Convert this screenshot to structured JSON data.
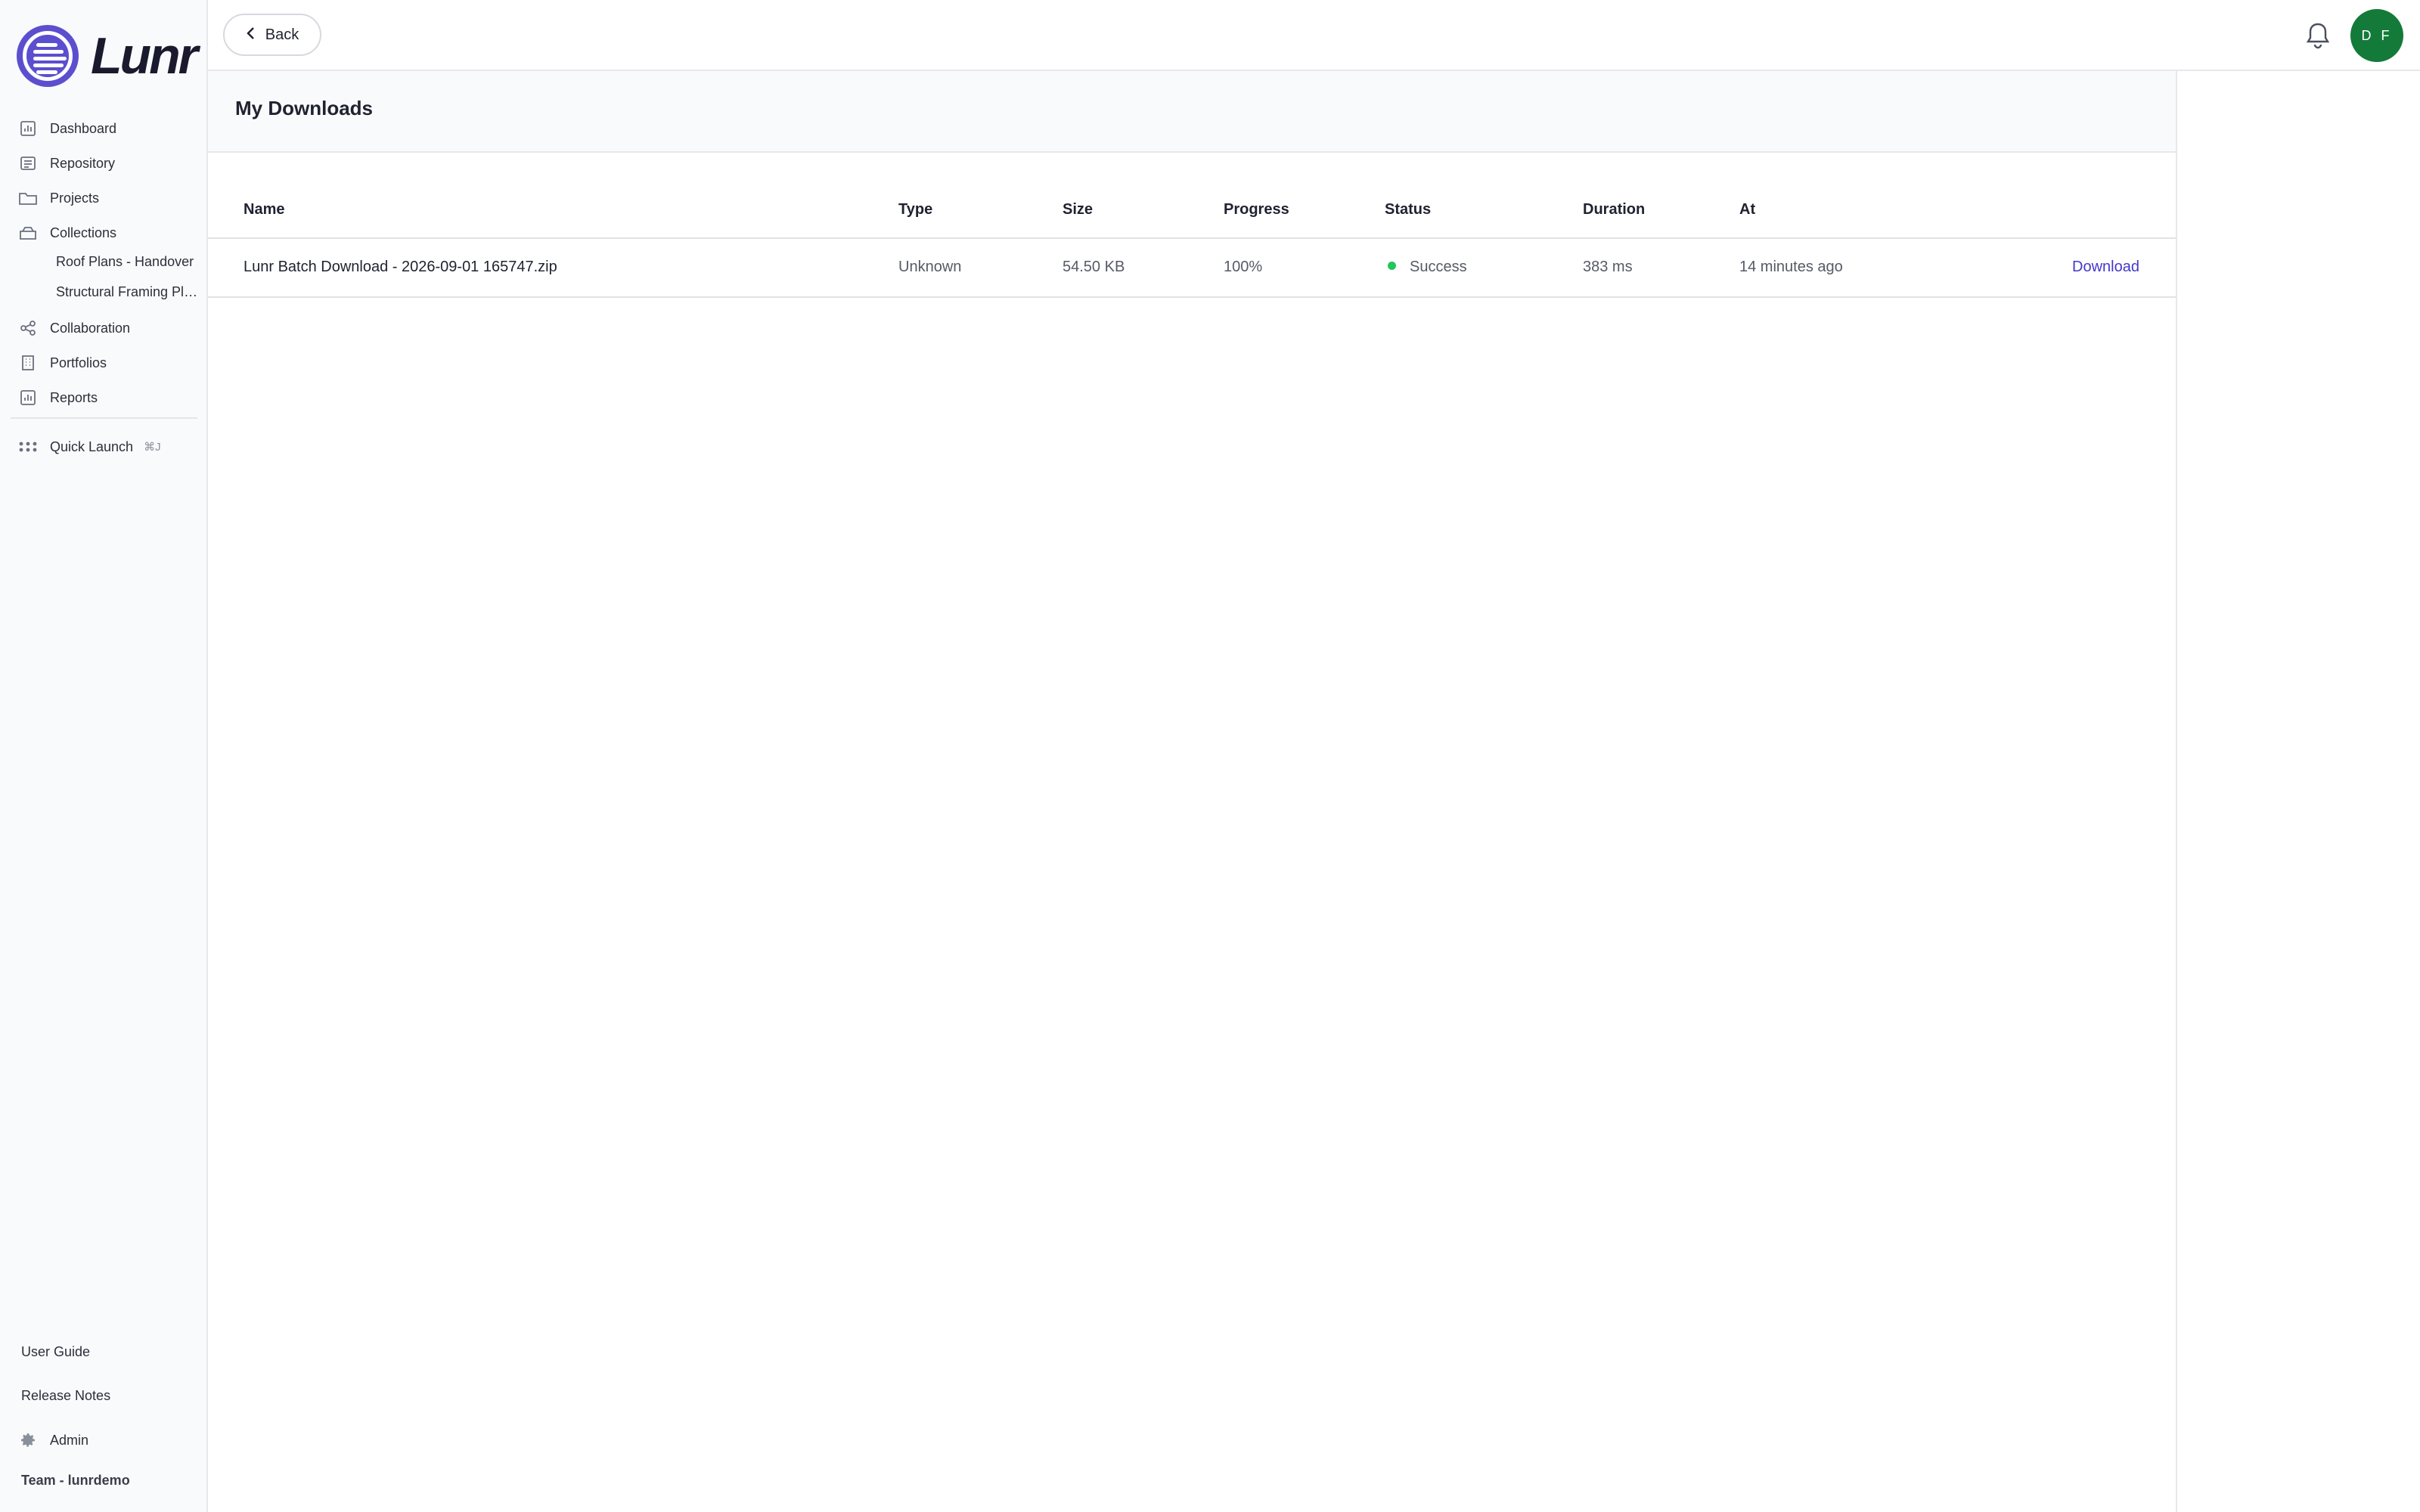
{
  "brand": {
    "name": "Lunr"
  },
  "sidebar": {
    "items": [
      {
        "label": "Dashboard",
        "icon": "chart-icon"
      },
      {
        "label": "Repository",
        "icon": "repository-icon"
      },
      {
        "label": "Projects",
        "icon": "folder-icon"
      },
      {
        "label": "Collections",
        "icon": "collection-icon"
      },
      {
        "label": "Collaboration",
        "icon": "share-icon"
      },
      {
        "label": "Portfolios",
        "icon": "building-icon"
      },
      {
        "label": "Reports",
        "icon": "chart-icon"
      }
    ],
    "collections": [
      "Roof Plans - Handover",
      "Structural Framing Plans"
    ],
    "quick_launch": {
      "label": "Quick Launch",
      "shortcut": "⌘J",
      "icon": "grid-dots-icon"
    },
    "bottom": {
      "user_guide": "User Guide",
      "release_notes": "Release Notes",
      "admin": "Admin",
      "team": "Team - lunrdemo"
    }
  },
  "topbar": {
    "back_label": "Back",
    "avatar_initials": "D F",
    "avatar_color": "#137a3a"
  },
  "page": {
    "title": "My Downloads"
  },
  "table": {
    "columns": [
      "Name",
      "Type",
      "Size",
      "Progress",
      "Status",
      "Duration",
      "At"
    ],
    "rows": [
      {
        "name": "Lunr Batch Download - 2026-09-01 165747.zip",
        "type": "Unknown",
        "size": "54.50 KB",
        "progress": "100%",
        "status": "Success",
        "status_color": "#22c55e",
        "duration": "383 ms",
        "at": "14 minutes ago",
        "action": "Download"
      }
    ]
  },
  "colors": {
    "accent": "#5b4fcf",
    "link": "#4338ca"
  }
}
